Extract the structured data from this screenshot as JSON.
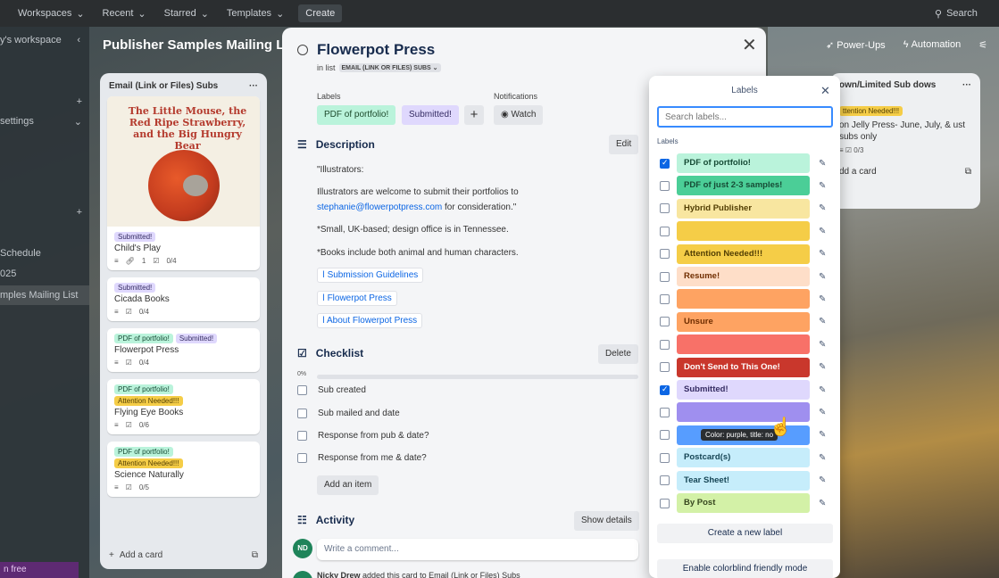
{
  "topbar": {
    "workspaces": "Workspaces",
    "recent": "Recent",
    "starred": "Starred",
    "templates": "Templates",
    "create": "Create",
    "search": "Search"
  },
  "sidebar": {
    "workspace": "y's workspace",
    "settings": "settings",
    "item_schedule": "Schedule",
    "item_025": "025",
    "item_active": "mples Mailing List",
    "trial": "n free"
  },
  "board": {
    "title": "Publisher Samples Mailing List",
    "power_ups": "Power-Ups",
    "automation": "Automation"
  },
  "list": {
    "title": "Email (Link or Files) Subs",
    "cover_title": "The Little Mouse, the Red Ripe Strawberry, and the Big Hungry Bear",
    "add_card": "Add a card",
    "cards": [
      {
        "tags": [
          "Submitted!"
        ],
        "title": "Child's Play",
        "attach": "1",
        "check": "0/4"
      },
      {
        "tags": [
          "Submitted!"
        ],
        "title": "Cicada Books",
        "check": "0/4"
      },
      {
        "tags": [
          "PDF of portfolio!",
          "Submitted!"
        ],
        "title": "Flowerpot Press",
        "check": "0/4"
      },
      {
        "tags": [
          "PDF of portfolio!",
          "Attention Needed!!!"
        ],
        "title": "Flying Eye Books",
        "check": "0/6"
      },
      {
        "tags": [
          "PDF of portfolio!",
          "Attention Needed!!!"
        ],
        "title": "Science Naturally",
        "check": "0/5"
      }
    ]
  },
  "right_list": {
    "title": "own/Limited Sub dows",
    "tag": "ttention Needed!!!",
    "text": "on Jelly Press- June, July, & ust subs only",
    "check": "0/3",
    "add": "dd a card"
  },
  "modal": {
    "title": "Flowerpot Press",
    "in_list": "in list",
    "list_name": "EMAIL (LINK OR FILES) SUBS",
    "labels_heading": "Labels",
    "notifications_heading": "Notifications",
    "label1": "PDF of portfolio!",
    "label2": "Submitted!",
    "watch": "Watch",
    "description_heading": "Description",
    "edit": "Edit",
    "desc_line1": "\"Illustrators:",
    "desc_line2": "Illustrators are welcome to submit their portfolios to",
    "desc_email": "stephanie@flowerpotpress.com",
    "desc_line3": " for consideration.\"",
    "desc_line4": "*Small, UK-based; design office is in Tennessee.",
    "desc_line5": "*Books include both animal and human characters.",
    "attach1": "Submission Guidelines",
    "attach2": "Flowerpot Press",
    "attach3": "About Flowerpot Press",
    "checklist_heading": "Checklist",
    "delete": "Delete",
    "progress": "0%",
    "progress_value": 0,
    "checklist": [
      "Sub created",
      "Sub mailed and date",
      "Response from pub & date?",
      "Response from me & date?"
    ],
    "add_item": "Add an item",
    "activity_heading": "Activity",
    "show_details": "Show details",
    "avatar": "ND",
    "comment_placeholder": "Write a comment...",
    "activity_user": "Nicky Drew",
    "activity_text": " added this card to Email (Link or Files) Subs"
  },
  "labels_popover": {
    "title": "Labels",
    "search_placeholder": "Search labels...",
    "sub_label": "Labels",
    "create": "Create a new label",
    "colorblind": "Enable colorblind friendly mode",
    "tooltip": "Color: purple, title: no",
    "items": [
      {
        "text": "PDF of portfolio!",
        "checked": true,
        "bg": "#baf3db",
        "fg": "#164b35"
      },
      {
        "text": "PDF of just 2-3 samples!",
        "checked": false,
        "bg": "#4bce97",
        "fg": "#164b35"
      },
      {
        "text": "Hybrid Publisher",
        "checked": false,
        "bg": "#f8e6a0",
        "fg": "#533f04"
      },
      {
        "text": "",
        "checked": false,
        "bg": "#f5cd47",
        "fg": "#533f04"
      },
      {
        "text": "Attention Needed!!!",
        "checked": false,
        "bg": "#f5cd47",
        "fg": "#533f04"
      },
      {
        "text": "Resume!",
        "checked": false,
        "bg": "#fedec8",
        "fg": "#702e00"
      },
      {
        "text": "",
        "checked": false,
        "bg": "#fea362",
        "fg": "#702e00"
      },
      {
        "text": "Unsure",
        "checked": false,
        "bg": "#fea362",
        "fg": "#702e00"
      },
      {
        "text": "",
        "checked": false,
        "bg": "#f87168",
        "fg": "#5d1f1a"
      },
      {
        "text": "Don't Send to This One!",
        "checked": false,
        "bg": "#c9372c",
        "fg": "#ffffff"
      },
      {
        "text": "Submitted!",
        "checked": true,
        "bg": "#dfd8fd",
        "fg": "#352c63"
      },
      {
        "text": "",
        "checked": false,
        "bg": "#9f8fef",
        "fg": "#352c63"
      },
      {
        "text": "",
        "checked": false,
        "bg": "#579dff",
        "fg": "#ffffff"
      },
      {
        "text": "Postcard(s)",
        "checked": false,
        "bg": "#c6edfb",
        "fg": "#164555"
      },
      {
        "text": "Tear Sheet!",
        "checked": false,
        "bg": "#c6edfb",
        "fg": "#164555"
      },
      {
        "text": "By Post",
        "checked": false,
        "bg": "#d3f1a7",
        "fg": "#37471f"
      }
    ]
  }
}
